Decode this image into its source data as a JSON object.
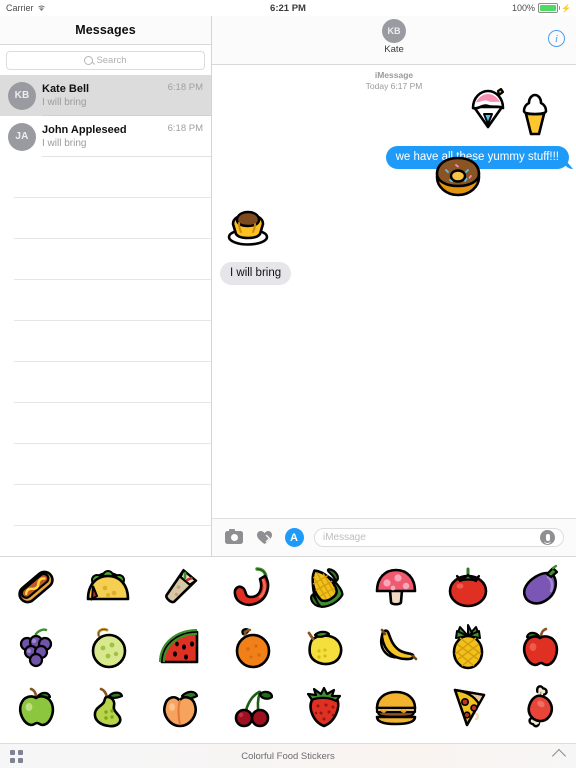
{
  "status_bar": {
    "carrier": "Carrier",
    "wifi_icon": "wifi-icon",
    "time": "6:21 PM",
    "battery_percent": "100%",
    "battery_icon": "battery-full-icon"
  },
  "sidebar": {
    "title": "Messages",
    "search": {
      "placeholder": "Search",
      "icon": "search-icon"
    },
    "conversations": [
      {
        "initials": "KB",
        "name": "Kate Bell",
        "preview": "I will bring",
        "time": "6:18 PM",
        "selected": true
      },
      {
        "initials": "JA",
        "name": "John Appleseed",
        "preview": "I will bring",
        "time": "6:18 PM",
        "selected": false
      }
    ],
    "empty_row_count": 9
  },
  "thread": {
    "avatar_initials": "KB",
    "contact_name": "Kate",
    "info_button": "info-icon",
    "service_label": "iMessage",
    "timestamp": "Today 6:17 PM",
    "messages": [
      {
        "type": "sticker",
        "name": "shaved-ice-sticker",
        "side": "outgoing"
      },
      {
        "type": "sticker",
        "name": "soft-serve-ice-cream-sticker",
        "side": "outgoing"
      },
      {
        "type": "text",
        "text": "we have all these yummy stuff!!!",
        "side": "outgoing"
      },
      {
        "type": "sticker",
        "name": "donut-sticker",
        "side": "outgoing"
      },
      {
        "type": "sticker",
        "name": "custard-pudding-sticker",
        "side": "incoming"
      },
      {
        "type": "text",
        "text": "I will bring",
        "side": "incoming"
      }
    ]
  },
  "input_bar": {
    "camera_icon": "camera-icon",
    "digital_touch_icon": "digital-touch-heart-icon",
    "app_store_icon": "imessage-apps-icon",
    "placeholder": "iMessage",
    "mic_icon": "microphone-icon"
  },
  "sticker_drawer": {
    "stickers": [
      {
        "name": "hot-dog-sticker",
        "label": "Hot Dog"
      },
      {
        "name": "taco-sticker",
        "label": "Taco"
      },
      {
        "name": "burrito-sticker",
        "label": "Burrito"
      },
      {
        "name": "chili-pepper-sticker",
        "label": "Chili Pepper"
      },
      {
        "name": "corn-sticker",
        "label": "Corn"
      },
      {
        "name": "mushroom-sticker",
        "label": "Mushroom"
      },
      {
        "name": "tomato-sticker",
        "label": "Tomato"
      },
      {
        "name": "eggplant-sticker",
        "label": "Eggplant"
      },
      {
        "name": "grapes-sticker",
        "label": "Grapes"
      },
      {
        "name": "melon-sticker",
        "label": "Melon"
      },
      {
        "name": "watermelon-sticker",
        "label": "Watermelon"
      },
      {
        "name": "orange-sticker",
        "label": "Orange"
      },
      {
        "name": "lemon-sticker",
        "label": "Lemon"
      },
      {
        "name": "banana-sticker",
        "label": "Banana"
      },
      {
        "name": "pineapple-sticker",
        "label": "Pineapple"
      },
      {
        "name": "red-apple-sticker",
        "label": "Red Apple"
      },
      {
        "name": "green-apple-sticker",
        "label": "Green Apple"
      },
      {
        "name": "pear-sticker",
        "label": "Pear"
      },
      {
        "name": "peach-sticker",
        "label": "Peach"
      },
      {
        "name": "cherries-sticker",
        "label": "Cherries"
      },
      {
        "name": "strawberry-sticker",
        "label": "Strawberry"
      },
      {
        "name": "hamburger-sticker",
        "label": "Hamburger"
      },
      {
        "name": "pizza-sticker",
        "label": "Pizza"
      },
      {
        "name": "meat-on-bone-sticker",
        "label": "Meat on Bone"
      }
    ]
  },
  "bottom_bar": {
    "grid_icon": "app-grid-icon",
    "pack_name": "Colorful Food Stickers",
    "expand_icon": "chevron-up-icon"
  },
  "colors": {
    "outgoing_bubble": "#1e9bf8",
    "incoming_bubble": "#e6e5ea",
    "accent": "#4a9ef6",
    "selected_row": "#dcdcdd"
  }
}
